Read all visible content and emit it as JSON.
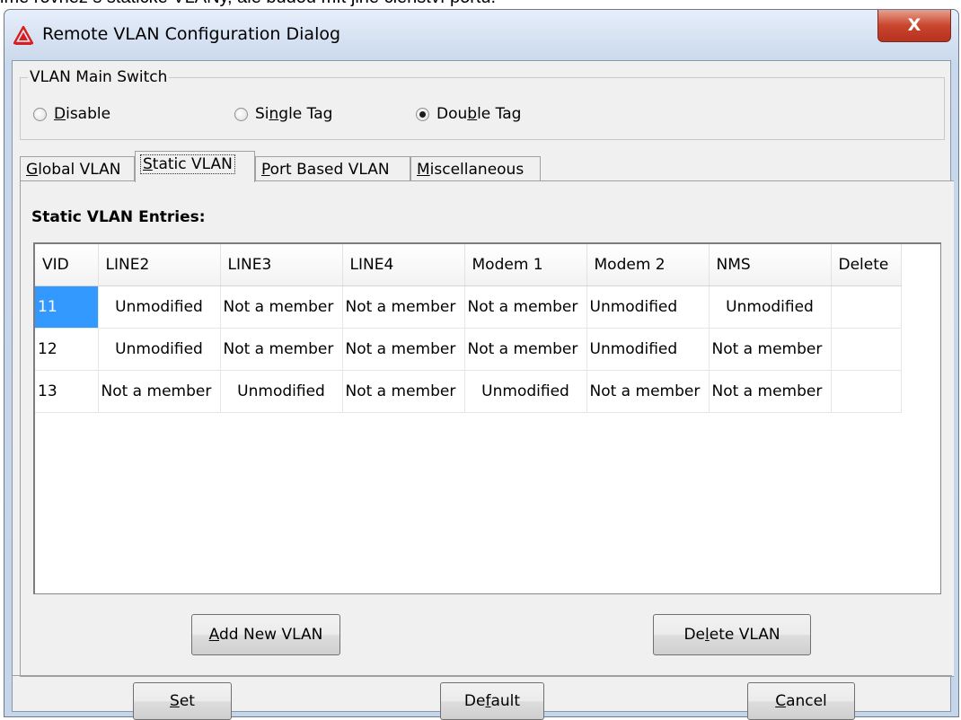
{
  "background_text": "ime rovněž s statické VLANy, ale budou mít jiné členství portů.",
  "window": {
    "title": "Remote VLAN Configuration Dialog",
    "close_label": "X"
  },
  "switch_group": {
    "legend": "VLAN Main Switch",
    "options": [
      {
        "pre": "",
        "u": "D",
        "post": "isable",
        "checked": false
      },
      {
        "pre": "Si",
        "u": "n",
        "post": "gle Tag",
        "checked": false
      },
      {
        "pre": "Dou",
        "u": "b",
        "post": "le Tag",
        "checked": true
      }
    ]
  },
  "tabs": [
    {
      "pre": "",
      "u": "G",
      "post": "lobal VLAN"
    },
    {
      "pre": "",
      "u": "S",
      "post": "tatic VLAN"
    },
    {
      "pre": "",
      "u": "P",
      "post": "ort Based VLAN"
    },
    {
      "pre": "",
      "u": "M",
      "post": "iscellaneous"
    }
  ],
  "section_title": "Static VLAN Entries:",
  "table": {
    "columns": [
      "VID",
      "LINE2",
      "LINE3",
      "LINE4",
      "Modem 1",
      "Modem 2",
      "NMS",
      "Delete"
    ],
    "rows": [
      [
        "11",
        "Unmodified",
        "Not a member",
        "Not a member",
        "Not a member",
        "Unmodified",
        "Unmodified",
        ""
      ],
      [
        "12",
        "Unmodified",
        "Not a member",
        "Not a member",
        "Not a member",
        "Unmodified",
        "Not a member",
        ""
      ],
      [
        "13",
        "Not a member",
        "Unmodified",
        "Not a member",
        "Unmodified",
        "Not a member",
        "Not a member",
        ""
      ]
    ]
  },
  "panel_buttons": {
    "add": {
      "pre": "",
      "u": "A",
      "post": "dd New VLAN"
    },
    "delete": {
      "pre": "De",
      "u": "l",
      "post": "ete VLAN"
    }
  },
  "footer_buttons": {
    "set": {
      "pre": "",
      "u": "S",
      "post": "et"
    },
    "default": {
      "pre": "De",
      "u": "f",
      "post": "ault"
    },
    "cancel": {
      "pre": "",
      "u": "C",
      "post": "ancel"
    }
  },
  "colors": {
    "selection": "#3399ff",
    "close_button": "#c9452c",
    "title_gradient": "#c9d8ec"
  }
}
